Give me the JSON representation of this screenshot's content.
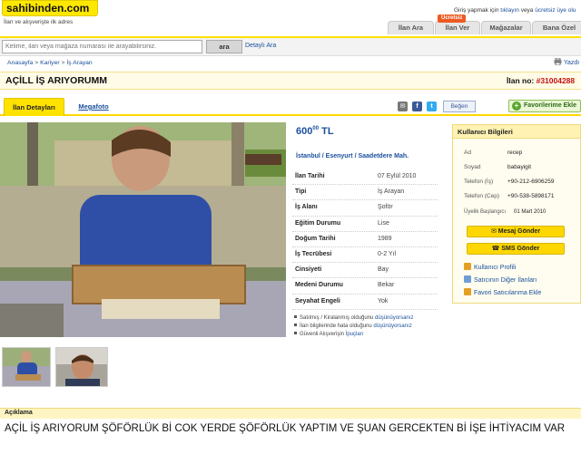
{
  "header": {
    "logo": "sahibinden.com",
    "tagline": "İlan ve alışverişte ilk adres",
    "login_prefix": "Giriş yapmak için ",
    "login_link1": "tıklayın",
    "login_mid": " veya ",
    "login_link2": "ücretsiz üye olu",
    "badge": "Ücretsiz",
    "tabs": [
      "İlan Ara",
      "İlan Ver",
      "Mağazalar",
      "Bana Özel"
    ]
  },
  "search": {
    "placeholder": "Kelime, ilan veya mağaza numarası ile arayabilirsiniz.",
    "button": "ara",
    "detailed": "Detaylı Ara"
  },
  "breadcrumb": {
    "items": [
      "Anasayfa",
      "Kariyer",
      "İş Arayan"
    ],
    "sep": " > ",
    "print": "Yazdı"
  },
  "listing": {
    "title": "AÇİLL İŞ ARIYORUMM",
    "ad_no_label": "İlan no: ",
    "ad_no": "#31004288",
    "tab_details": "İlan Detayları",
    "tab_mega": "Megafoto",
    "like": "Beğen",
    "favorite": "Favorilerime Ekle",
    "price": "600",
    "price_decimal": "00",
    "currency": "TL",
    "location": "İstanbul / Esenyurt / Saadetdere Mah.",
    "fields": [
      {
        "label": "İlan Tarihi",
        "value": "07 Eylül 2010"
      },
      {
        "label": "Tipi",
        "value": "İş Arayan"
      },
      {
        "label": "İş Alanı",
        "value": "Şoför"
      },
      {
        "label": "Eğitim Durumu",
        "value": "Lise"
      },
      {
        "label": "Doğum Tarihi",
        "value": "1989"
      },
      {
        "label": "İş Tecrübesi",
        "value": "0-2 Yıl"
      },
      {
        "label": "Cinsiyeti",
        "value": "Bay"
      },
      {
        "label": "Medeni Durumu",
        "value": "Bekar"
      },
      {
        "label": "Seyahat Engeli",
        "value": "Yok"
      }
    ],
    "notes": [
      {
        "text": "Satılmış / Kiralanmış olduğunu ",
        "link": "düşünüyorsanız"
      },
      {
        "text": "İlan bilgilerinde hata olduğunu ",
        "link": "düşünüyorsanız"
      },
      {
        "text": "Güvenli Alışverişin ",
        "link": "İpuçları"
      }
    ]
  },
  "user": {
    "heading": "Kullanıcı Bilgileri",
    "rows": [
      {
        "label": "Ad",
        "value": "recep"
      },
      {
        "label": "Soyad",
        "value": "babayigit"
      },
      {
        "label": "Telefon (İş)",
        "value": "+90-212-6906259"
      },
      {
        "label": "Telefon (Cep)",
        "value": "+90-538-5898171"
      }
    ],
    "since_label": "Üyelik Başlangıcı",
    "since": "01 Mart 2010",
    "btn_message": "Mesaj Gönder",
    "btn_sms": "SMS Gönder",
    "links": [
      "Kullanıcı Profili",
      "Satıcının Diğer İlanları",
      "Favori Satıcılarıma Ekle"
    ]
  },
  "description": {
    "heading": "Açıklama",
    "text": "AÇİL İŞ ARIYORUM ŞÖFÖRLÜK Bİ COK YERDE ŞÖFÖRLÜK YAPTIM VE ŞUAN GERCEKTEN Bİ İŞE İHTİYACIM VAR"
  },
  "colors": {
    "brand_yellow": "#ffe200",
    "link_blue": "#1a4f9c",
    "ad_no_red": "#c41212"
  }
}
